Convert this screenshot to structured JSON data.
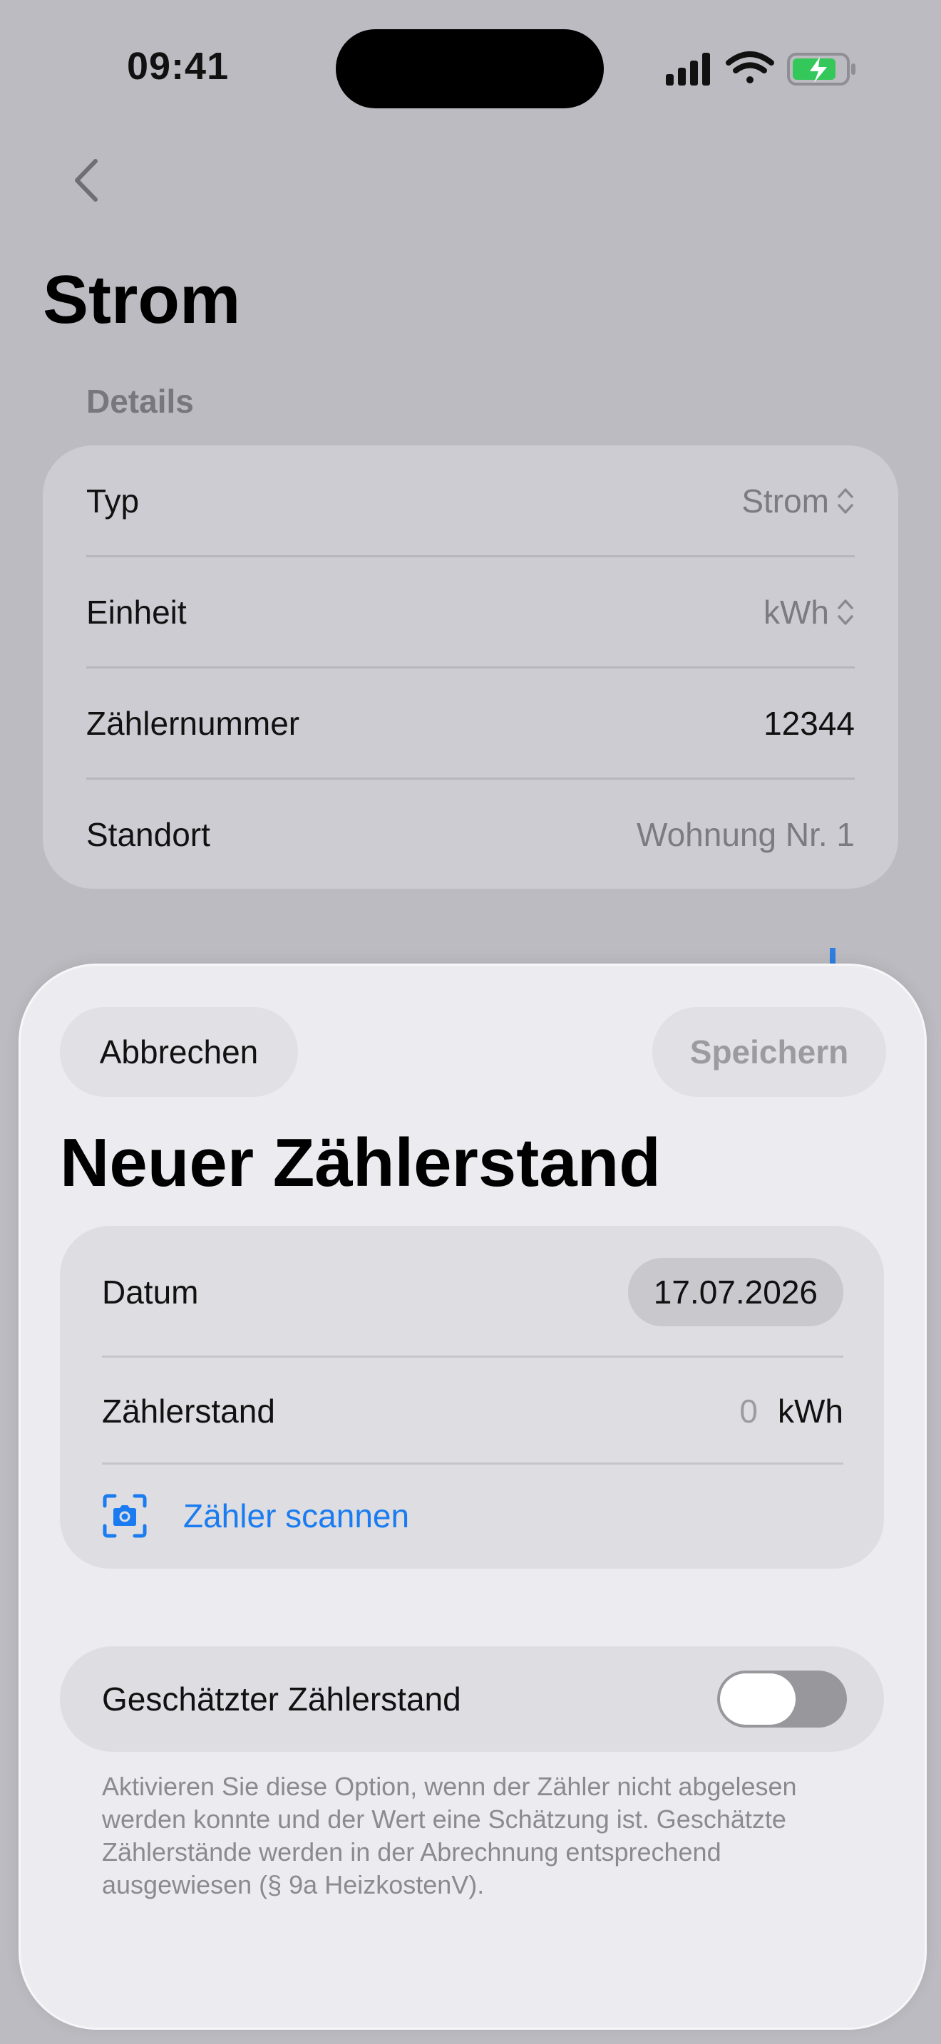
{
  "status_bar": {
    "time": "09:41",
    "icons": [
      "cellular-signal-icon",
      "wifi-icon",
      "battery-charging-icon"
    ],
    "battery_color": "#34c759"
  },
  "page": {
    "title": "Strom",
    "details_header": "Details",
    "details": [
      {
        "label": "Typ",
        "value": "Strom",
        "picker": true
      },
      {
        "label": "Einheit",
        "value": "kWh",
        "picker": true
      },
      {
        "label": "Zählernummer",
        "value": "12344",
        "picker": false
      },
      {
        "label": "Standort",
        "value": "Wohnung Nr. 1",
        "picker": false
      }
    ]
  },
  "sheet": {
    "cancel_label": "Abbrechen",
    "save_label": "Speichern",
    "title": "Neuer Zählerstand",
    "date_label": "Datum",
    "date_value": "17.07.2026",
    "reading_label": "Zählerstand",
    "reading_value": "0",
    "reading_unit": "kWh",
    "scan_label": "Zähler scannen",
    "estimated_label": "Geschätzter Zählerstand",
    "estimated_on": false,
    "footnote": "Aktivieren Sie diese Option, wenn der Zähler nicht abgelesen werden konnte und der Wert eine Schätzung ist. Geschätzte Zählerstände werden in der Abrechnung entsprechend ausgewiesen (§ 9a HeizkostenV)."
  },
  "colors": {
    "accent": "#1a7cf0"
  }
}
